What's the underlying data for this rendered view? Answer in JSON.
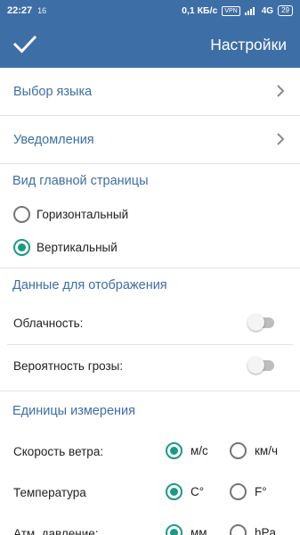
{
  "status_bar": {
    "time": "22:27",
    "sim": "16",
    "speed": "0,1 КБ/с",
    "vpn": "VPN",
    "network": "4G",
    "battery": "29"
  },
  "app_bar": {
    "confirm_icon": "check-icon",
    "title": "Настройки"
  },
  "nav_items": [
    {
      "label": "Выбор языка",
      "icon": "chevron-right-icon"
    },
    {
      "label": "Уведомления",
      "icon": "chevron-right-icon"
    }
  ],
  "home_view": {
    "header": "Вид главной страницы",
    "options": [
      {
        "label": "Горизонтальный",
        "selected": false
      },
      {
        "label": "Вертикальный",
        "selected": true
      }
    ]
  },
  "display_data": {
    "header": "Данные для отображения",
    "toggles": [
      {
        "label": "Облачность:",
        "on": false
      },
      {
        "label": "Вероятность грозы:",
        "on": false
      }
    ]
  },
  "units": {
    "header": "Единицы измерения",
    "rows": [
      {
        "label": "Скорость ветра:",
        "options": [
          "м/с",
          "км/ч"
        ],
        "selected": 0
      },
      {
        "label": "Температура",
        "options": [
          "C°",
          "F°"
        ],
        "selected": 0
      },
      {
        "label": "Атм. давление:",
        "options": [
          "мм",
          "hPa"
        ],
        "selected": 0
      }
    ]
  },
  "colors": {
    "primary": "#3e6ea6",
    "accent": "#1a9a84",
    "switch_off": "#bdbdbd"
  }
}
